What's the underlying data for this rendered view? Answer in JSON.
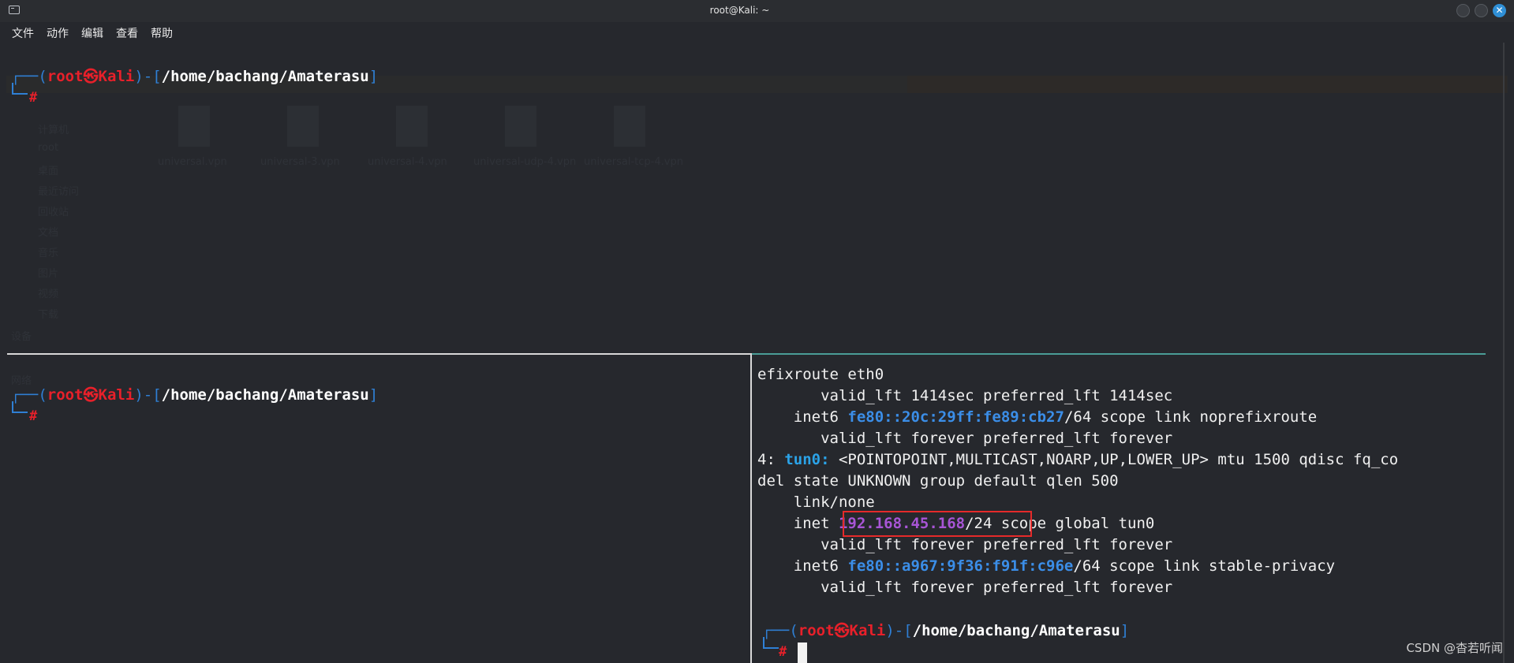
{
  "window": {
    "title": "root@Kali: ~",
    "close_glyph": "✕"
  },
  "menu": [
    "文件",
    "动作",
    "编辑",
    "查看",
    "帮助"
  ],
  "ghost": {
    "files": [
      "universal.vpn",
      "universal-3.vpn",
      "universal-4.vpn",
      "universal-udp-4.vpn",
      "universal-tcp-4.vpn"
    ],
    "sidebar": [
      "计算机",
      "root",
      "桌面",
      "最近访问",
      "回收站",
      "文档",
      "音乐",
      "图片",
      "视频",
      "下载"
    ],
    "sections": [
      "设备",
      "网络"
    ]
  },
  "prompt": {
    "open": "┌──(",
    "user": "root",
    "skull": "㉿",
    "host": "Kali",
    "mid": ")-[",
    "path": "/home/bachang/Amaterasu",
    "close": "]",
    "hash": "#"
  },
  "output": {
    "line1": "efixroute eth0",
    "line2": "       valid_lft 1414sec preferred_lft 1414sec",
    "line3_pre": "    inet6 ",
    "line3_addr": "fe80::20c:29ff:fe89:cb27",
    "line3_post": "/64 scope link noprefixroute",
    "line4": "       valid_lft forever preferred_lft forever",
    "line5_pre": "4: ",
    "line5_iface": "tun0:",
    "line5_post": " <POINTOPOINT,MULTICAST,NOARP,UP,LOWER_UP> mtu 1500 qdisc fq_co",
    "line6": "del state UNKNOWN group default qlen 500",
    "line7": "    link/none",
    "line8_pre": "    inet ",
    "line8_ip": "192.168.45.168",
    "line8_mask": "/24",
    "line8_post": " scope global tun0",
    "line9": "       valid_lft forever preferred_lft forever",
    "line10_pre": "    inet6 ",
    "line10_addr": "fe80::a967:9f36:f91f:c96e",
    "line10_post": "/64 scope link stable-privacy",
    "line11": "       valid_lft forever preferred_lft forever"
  },
  "watermark": "CSDN @杳若听闻"
}
